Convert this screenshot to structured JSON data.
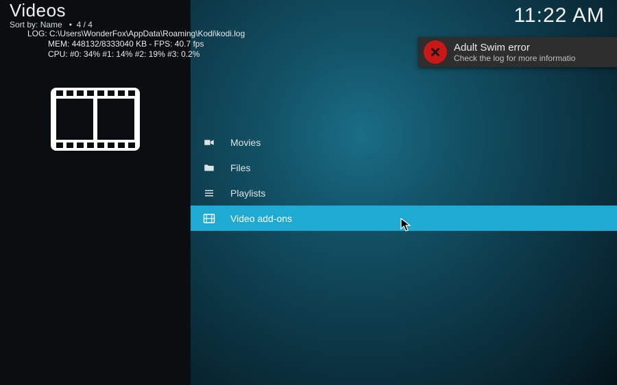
{
  "header": {
    "title": "Videos",
    "sort_prefix": "Sort by: ",
    "sort_value": "Name",
    "count": "4 / 4"
  },
  "debug": {
    "log": "LOG: C:\\Users\\WonderFox\\AppData\\Roaming\\Kodi\\kodi.log",
    "mem": "MEM: 448132/8333040 KB - FPS: 40.7 fps",
    "cpu": "CPU: #0:  34% #1:  14% #2:  19% #3: 0.2%"
  },
  "clock": "11:22 AM",
  "toast": {
    "title": "Adult Swim error",
    "message": "Check the log for more informatio"
  },
  "menu": {
    "items": [
      {
        "label": "Movies",
        "icon": "camera-icon",
        "selected": false
      },
      {
        "label": "Files",
        "icon": "folder-icon",
        "selected": false
      },
      {
        "label": "Playlists",
        "icon": "list-icon",
        "selected": false
      },
      {
        "label": "Video add-ons",
        "icon": "film-icon",
        "selected": true
      }
    ]
  }
}
